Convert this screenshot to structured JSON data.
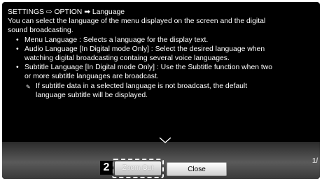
{
  "help": {
    "breadcrumb": {
      "part1": "SETTINGS",
      "arrow1": "⇨",
      "part2": "OPTION",
      "arrow2": "➡",
      "part3": "Language"
    },
    "intro_line1": "You can select the language of the menu displayed on the screen and the digital",
    "intro_line2": "sound broadcasting.",
    "bullet_glyph": "•",
    "bullets": [
      {
        "lines": [
          "Menu Language : Selects a language for the display text."
        ]
      },
      {
        "lines": [
          "Audio Language  [In Digital mode Only] : Select the desired language when",
          "watching digital broadcasting containg several voice languages."
        ]
      },
      {
        "lines": [
          "Subtitle Language [In Digital mode Only] : Use the Subtitle function when two",
          "or more subtitle languages are broadcast."
        ]
      }
    ],
    "note_glyph": "✎",
    "note_line1": "If subtitle data in a selected language is not broadcast, the default",
    "note_line2": "language subtitle will be displayed."
  },
  "footer": {
    "page_indicator": "1/",
    "step_badge": "2",
    "zoom_out_label": "Zoom Out",
    "close_label": "Close"
  }
}
